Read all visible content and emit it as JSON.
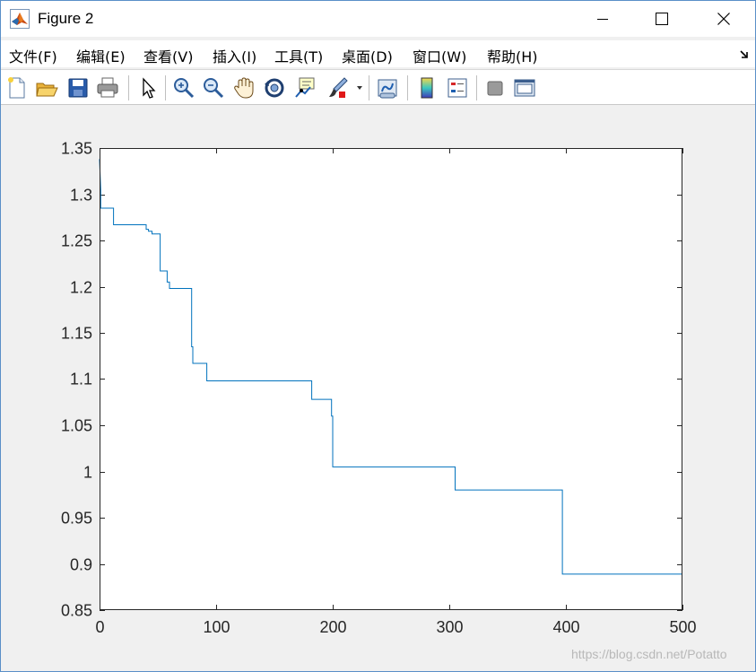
{
  "window": {
    "title": "Figure 2",
    "controls": [
      "minimize",
      "maximize",
      "close"
    ]
  },
  "menu": {
    "items": [
      "文件(F)",
      "编辑(E)",
      "查看(V)",
      "插入(I)",
      "工具(T)",
      "桌面(D)",
      "窗口(W)",
      "帮助(H)"
    ]
  },
  "toolbar": {
    "buttons": [
      "new-figure-icon",
      "open-file-icon",
      "save-icon",
      "print-icon",
      "pointer-icon",
      "zoom-in-icon",
      "zoom-out-icon",
      "pan-hand-icon",
      "rotate-3d-icon",
      "data-cursor-icon",
      "brush-icon",
      "link-plot-icon",
      "colorbar-icon",
      "legend-icon",
      "hide-plot-tools-icon",
      "show-plot-tools-icon"
    ]
  },
  "colors": {
    "line": "#0072bd",
    "axes_background": "#ffffff",
    "figure_background": "#f0f0f0"
  },
  "watermark": "https://blog.csdn.net/Potatto",
  "chart_data": {
    "type": "line",
    "xlim": [
      0,
      500
    ],
    "ylim": [
      0.85,
      1.35
    ],
    "xticks": [
      0,
      100,
      200,
      300,
      400,
      500
    ],
    "xtick_labels": [
      "0",
      "100",
      "200",
      "300",
      "400",
      "500"
    ],
    "yticks": [
      0.85,
      0.9,
      0.95,
      1.0,
      1.05,
      1.1,
      1.15,
      1.2,
      1.25,
      1.3,
      1.35
    ],
    "ytick_labels": [
      "0.85",
      "0.9",
      "0.95",
      "1",
      "1.05",
      "1.1",
      "1.15",
      "1.2",
      "1.25",
      "1.3",
      "1.35"
    ],
    "grid": false,
    "series": [
      {
        "x": [
          0,
          1,
          1,
          12,
          12,
          40,
          40,
          42,
          42,
          45,
          45,
          52,
          52,
          58,
          58,
          60,
          60,
          79,
          79,
          80,
          80,
          92,
          92,
          182,
          182,
          199,
          199,
          200,
          200,
          305,
          305,
          397,
          397,
          500
        ],
        "y": [
          1.338,
          1.305,
          1.285,
          1.285,
          1.267,
          1.267,
          1.262,
          1.262,
          1.26,
          1.26,
          1.257,
          1.257,
          1.217,
          1.217,
          1.205,
          1.205,
          1.198,
          1.198,
          1.135,
          1.135,
          1.117,
          1.117,
          1.098,
          1.098,
          1.078,
          1.078,
          1.06,
          1.06,
          1.005,
          1.005,
          0.98,
          0.98,
          0.889,
          0.889
        ]
      }
    ]
  }
}
